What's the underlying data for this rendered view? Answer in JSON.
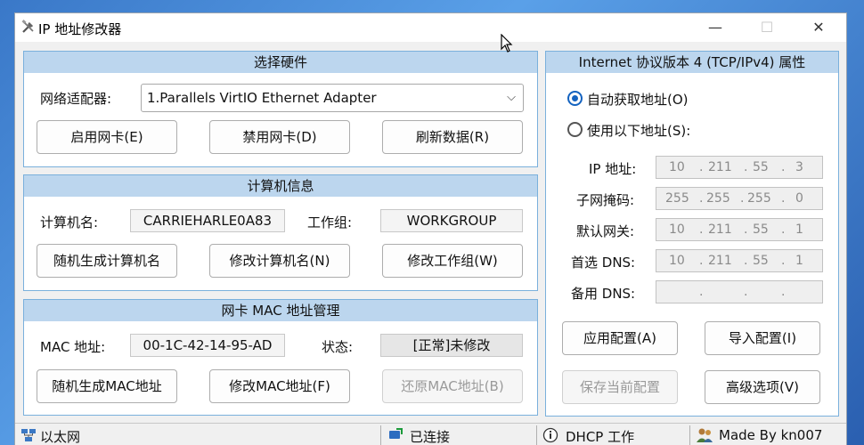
{
  "window": {
    "title": "IP 地址修改器",
    "controls": {
      "minimize": "—",
      "maximize": "☐",
      "close": "✕"
    }
  },
  "hardware": {
    "header": "选择硬件",
    "adapter_label": "网络适配器:",
    "adapter_value": "1.Parallels VirtIO Ethernet Adapter",
    "enable_btn": "启用网卡(E)",
    "disable_btn": "禁用网卡(D)",
    "refresh_btn": "刷新数据(R)"
  },
  "computer": {
    "header": "计算机信息",
    "name_label": "计算机名:",
    "name_value": "CARRIEHARLE0A83",
    "workgroup_label": "工作组:",
    "workgroup_value": "WORKGROUP",
    "random_name_btn": "随机生成计算机名",
    "modify_name_btn": "修改计算机名(N)",
    "modify_workgroup_btn": "修改工作组(W)"
  },
  "mac": {
    "header": "网卡 MAC 地址管理",
    "mac_label": "MAC 地址:",
    "mac_value": "00-1C-42-14-95-AD",
    "status_label": "状态:",
    "status_value": "[正常]未修改",
    "random_mac_btn": "随机生成MAC地址",
    "modify_mac_btn": "修改MAC地址(F)",
    "restore_mac_btn": "还原MAC地址(B)"
  },
  "ipv4": {
    "header": "Internet 协议版本 4 (TCP/IPv4) 属性",
    "auto_radio": "自动获取地址(O)",
    "manual_radio": "使用以下地址(S):",
    "ip_label": "IP 地址:",
    "ip": [
      "10",
      "211",
      "55",
      "3"
    ],
    "mask_label": "子网掩码:",
    "mask": [
      "255",
      "255",
      "255",
      "0"
    ],
    "gateway_label": "默认网关:",
    "gateway": [
      "10",
      "211",
      "55",
      "1"
    ],
    "dns1_label": "首选 DNS:",
    "dns1": [
      "10",
      "211",
      "55",
      "1"
    ],
    "dns2_label": "备用 DNS:",
    "dns2": [
      "",
      "",
      "",
      ""
    ],
    "dot": ".",
    "apply_btn": "应用配置(A)",
    "import_btn": "导入配置(I)",
    "save_btn": "保存当前配置",
    "advanced_btn": "高级选项(V)"
  },
  "statusbar": {
    "network": "以太网",
    "connection": "已连接",
    "dhcp": "DHCP 工作",
    "author": "Made By kn007"
  },
  "colors": {
    "accent": "#1463c0",
    "group_header": "#bcd6ee",
    "group_border": "#7ab0dc"
  }
}
